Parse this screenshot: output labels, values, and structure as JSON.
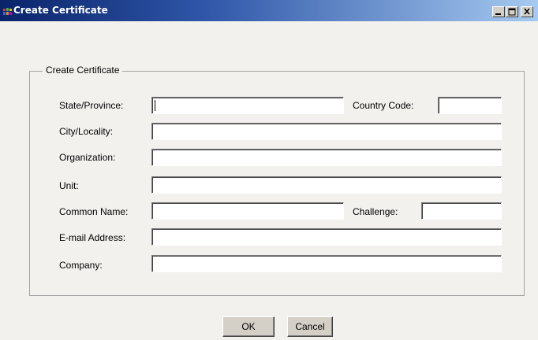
{
  "window": {
    "title": "Create Certificate",
    "icon": "app-icon",
    "controls": [
      "minimize-icon",
      "maximize-icon",
      "close-icon"
    ]
  },
  "group": {
    "legend": "Create Certificate"
  },
  "form": {
    "state_label": "State/Province:",
    "state_value": "",
    "country_label": "Country Code:",
    "country_value": "",
    "city_label": "City/Locality:",
    "city_value": "",
    "org_label": "Organization:",
    "org_value": "",
    "unit_label": "Unit:",
    "unit_value": "",
    "common_label": "Common Name:",
    "common_value": "",
    "challenge_label": "Challenge:",
    "challenge_value": "",
    "email_label": "E-mail Address:",
    "email_value": "",
    "company_label": "Company:",
    "company_value": ""
  },
  "buttons": {
    "ok": "OK",
    "cancel": "Cancel"
  },
  "colors": {
    "title_start": "#0a246a",
    "title_end": "#a6caf0",
    "dialog_bg": "#f2f1ee",
    "button_face": "#d4d0c8"
  }
}
